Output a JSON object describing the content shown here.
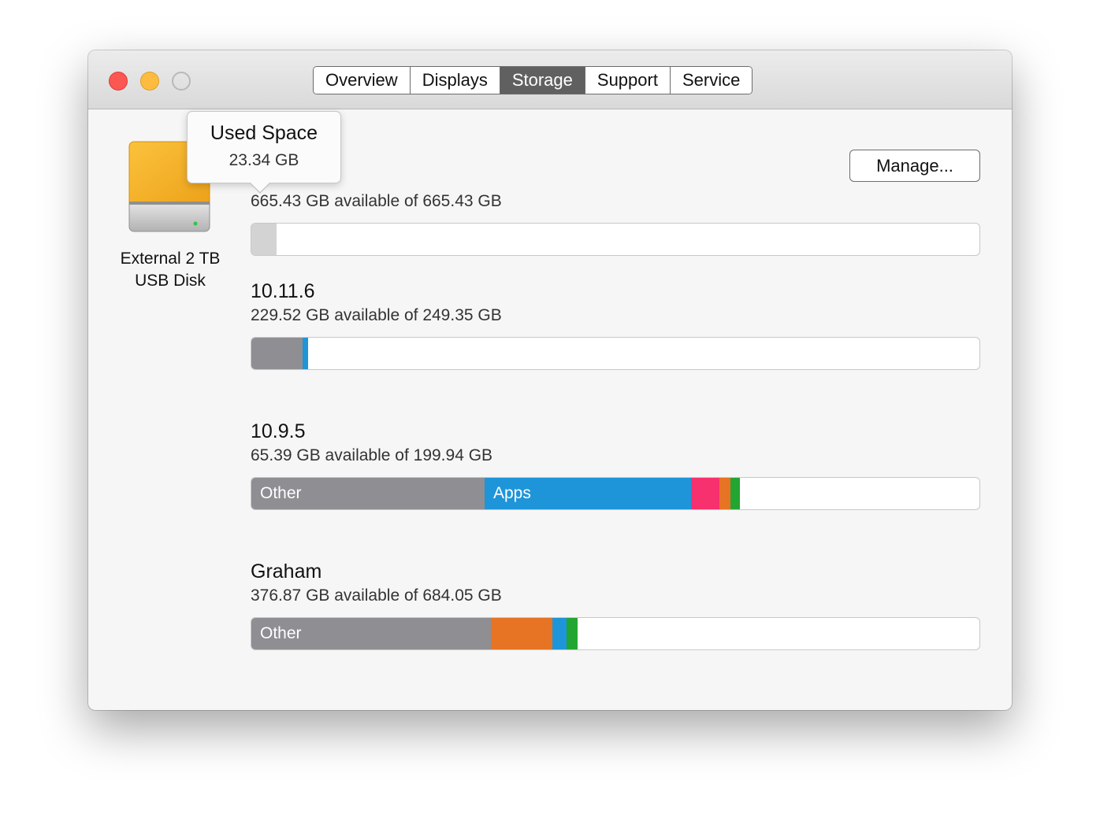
{
  "window": {
    "controls": [
      "close",
      "minimize",
      "zoom"
    ]
  },
  "tabs": [
    {
      "label": "Overview",
      "active": false
    },
    {
      "label": "Displays",
      "active": false
    },
    {
      "label": "Storage",
      "active": true
    },
    {
      "label": "Support",
      "active": false
    },
    {
      "label": "Service",
      "active": false
    }
  ],
  "disk": {
    "icon": "external-drive-icon",
    "label_line1": "External 2 TB",
    "label_line2": "USB Disk"
  },
  "manage_button": "Manage...",
  "tooltip": {
    "title": "Used Space",
    "value": "23.34 GB"
  },
  "volumes": [
    {
      "name": "",
      "available": "665.43 GB available of 665.43 GB",
      "segments": [
        {
          "category": "used",
          "label": "",
          "fraction": 0.035,
          "color": "#d3d3d3"
        }
      ]
    },
    {
      "name": "10.11.6",
      "available": "229.52 GB available of 249.35 GB",
      "segments": [
        {
          "category": "other",
          "label": "",
          "fraction": 0.07,
          "color": "#8e8e93"
        },
        {
          "category": "apps",
          "label": "",
          "fraction": 0.008,
          "color": "#1e95d9"
        }
      ]
    },
    {
      "name": "10.9.5",
      "available": "65.39 GB available of 199.94 GB",
      "segments": [
        {
          "category": "other",
          "label": "Other",
          "fraction": 0.32,
          "color": "#8e8e93"
        },
        {
          "category": "apps",
          "label": "Apps",
          "fraction": 0.284,
          "color": "#1e95d9"
        },
        {
          "category": "photos",
          "label": "",
          "fraction": 0.039,
          "color": "#f7306e"
        },
        {
          "category": "music",
          "label": "",
          "fraction": 0.015,
          "color": "#e67424"
        },
        {
          "category": "documents",
          "label": "",
          "fraction": 0.013,
          "color": "#23a532"
        }
      ]
    },
    {
      "name": "Graham",
      "available": "376.87 GB available of 684.05 GB",
      "segments": [
        {
          "category": "other",
          "label": "Other",
          "fraction": 0.329,
          "color": "#8e8e93"
        },
        {
          "category": "music",
          "label": "",
          "fraction": 0.084,
          "color": "#e67424"
        },
        {
          "category": "apps",
          "label": "",
          "fraction": 0.019,
          "color": "#1e95d9"
        },
        {
          "category": "documents",
          "label": "",
          "fraction": 0.015,
          "color": "#23a532"
        }
      ]
    }
  ]
}
